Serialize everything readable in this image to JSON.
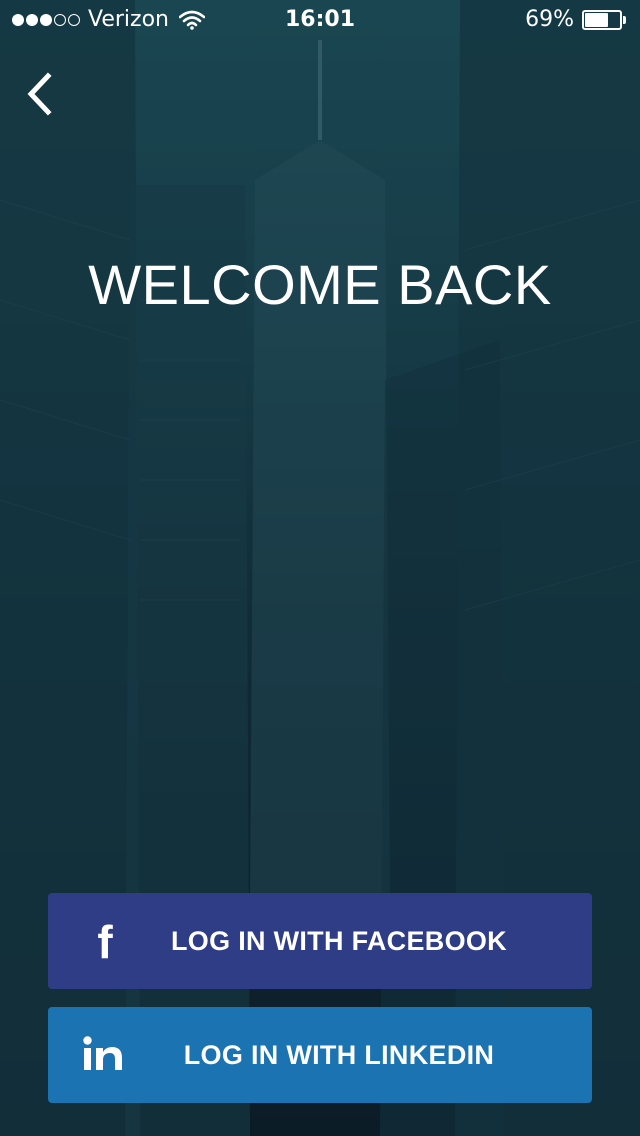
{
  "status_bar": {
    "carrier": "Verizon",
    "time": "16:01",
    "battery_percent": "69%",
    "battery_level": 0.69,
    "signal_bars_filled": 3,
    "signal_bars_total": 5
  },
  "header": {
    "title": "WELCOME BACK"
  },
  "buttons": {
    "facebook_label": "LOG IN WITH FACEBOOK",
    "linkedin_label": "LOG IN WITH LINKEDIN"
  },
  "icons": {
    "back": "chevron-left-icon",
    "facebook": "facebook-icon",
    "linkedin": "linkedin-icon",
    "wifi": "wifi-icon",
    "battery": "battery-icon"
  },
  "colors": {
    "facebook_button": "#2f3c86",
    "linkedin_button": "#1c73b1",
    "background_top": "#1f5560",
    "background_bottom": "#0c1d26"
  }
}
